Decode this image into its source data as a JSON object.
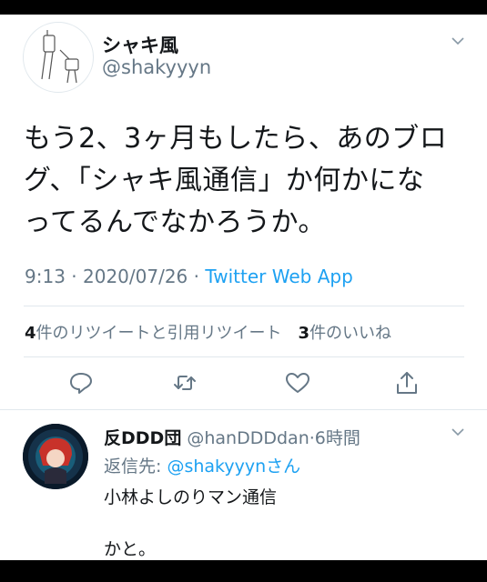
{
  "tweet": {
    "display_name": "シャキ風",
    "handle": "@shakyyyn",
    "text_lines": [
      "もう2、3ヶ月もしたら、あのブロ",
      "グ、「シャキ風通信」か何かにな",
      "ってるんでなかろうか。"
    ],
    "time": "9:13",
    "sep": " · ",
    "date": "2020/07/26",
    "source": "Twitter Web App",
    "retweet_count": "4",
    "retweet_label": "件のリツイートと引用リツイート",
    "like_count": "3",
    "like_label": "件のいいね"
  },
  "reply": {
    "display_name": "反DDD団",
    "handle_time": "@hanDDDdan·6時間",
    "reply_prefix": "返信先: ",
    "reply_target": "@shakyyynさん",
    "line1": "小林よしのりマン通信",
    "line2": "かと。"
  },
  "colors": {
    "link": "#1da1f2",
    "secondary": "#657786",
    "primary": "#14171a"
  },
  "icons": {
    "menu": "chevron-down-icon",
    "reply": "reply-icon",
    "retweet": "retweet-icon",
    "like": "heart-icon",
    "share": "share-icon"
  }
}
